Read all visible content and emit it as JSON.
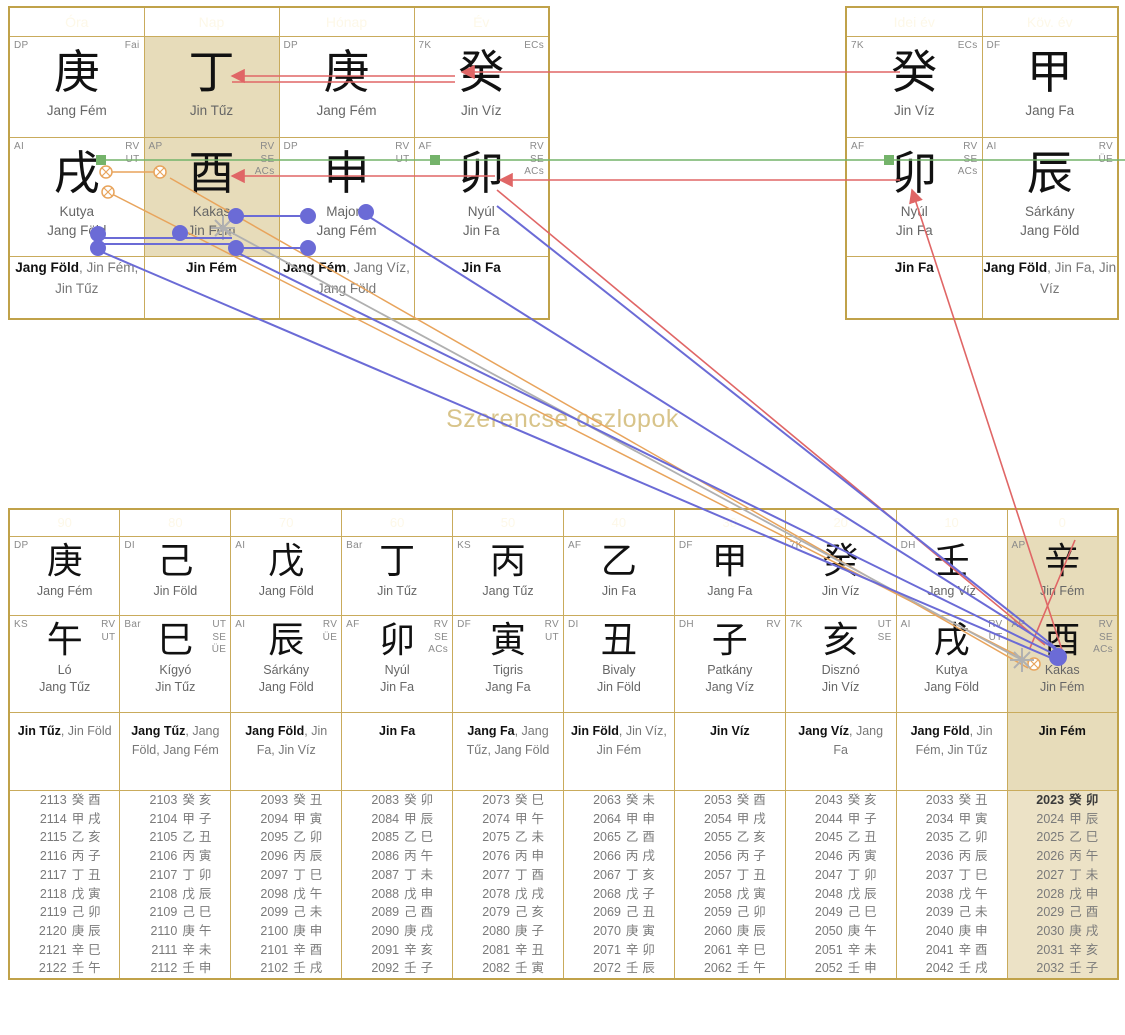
{
  "watermark": "Szerencse oszlopok",
  "natal": {
    "headers": [
      "Óra",
      "Nap",
      "Hónap",
      "Év"
    ],
    "stems": [
      {
        "tl": "DP",
        "tr": "Fai",
        "glyph": "庚",
        "element": "Jang Fém",
        "highlight": false
      },
      {
        "tl": "",
        "tr": "",
        "glyph": "丁",
        "element": "Jin Tűz",
        "highlight": true
      },
      {
        "tl": "DP",
        "tr": "",
        "glyph": "庚",
        "element": "Jang Fém",
        "highlight": false
      },
      {
        "tl": "7K",
        "tr": "ECs",
        "glyph": "癸",
        "element": "Jin Víz",
        "highlight": false
      }
    ],
    "branches": [
      {
        "tl": "AI",
        "tr": "RV\nUT",
        "glyph": "戌",
        "animal": "Kutya",
        "element": "Jang Föld",
        "highlight": false
      },
      {
        "tl": "AP",
        "tr": "RV\nSE\nACs",
        "glyph": "酉",
        "animal": "Kakas",
        "element": "Jin Fém",
        "highlight": true
      },
      {
        "tl": "DP",
        "tr": "RV\nUT",
        "glyph": "申",
        "animal": "Majom",
        "element": "Jang Fém",
        "highlight": false
      },
      {
        "tl": "AF",
        "tr": "RV\nSE\nACs",
        "glyph": "卯",
        "animal": "Nyúl",
        "element": "Jin Fa",
        "highlight": false
      }
    ],
    "hidden": [
      {
        "main": "Jang Föld",
        "rest": ", Jin Fém, Jin Tűz"
      },
      {
        "main": "Jin Fém",
        "rest": ""
      },
      {
        "main": "Jang Fém",
        "rest": ", Jang Víz, Jang Föld"
      },
      {
        "main": "Jin Fa",
        "rest": ""
      }
    ]
  },
  "annual": {
    "headers": [
      "Idei év",
      "Köv. év"
    ],
    "stems": [
      {
        "tl": "7K",
        "tr": "ECs",
        "glyph": "癸",
        "element": "Jin Víz"
      },
      {
        "tl": "DF",
        "tr": "",
        "glyph": "甲",
        "element": "Jang Fa"
      }
    ],
    "branches": [
      {
        "tl": "AF",
        "tr": "RV\nSE\nACs",
        "glyph": "卯",
        "animal": "Nyúl",
        "element": "Jin Fa"
      },
      {
        "tl": "AI",
        "tr": "RV\nÜE",
        "glyph": "辰",
        "animal": "Sárkány",
        "element": "Jang Föld"
      }
    ],
    "hidden": [
      {
        "main": "Jin Fa",
        "rest": ""
      },
      {
        "main": "Jang Föld",
        "rest": ", Jin Fa, Jin Víz"
      }
    ]
  },
  "luck": {
    "headers": [
      "90",
      "80",
      "70",
      "60",
      "50",
      "40",
      "30",
      "20",
      "10",
      "0"
    ],
    "stems": [
      {
        "tl": "DP",
        "tr": "",
        "glyph": "庚",
        "element": "Jang Fém",
        "highlight": false
      },
      {
        "tl": "DI",
        "tr": "",
        "glyph": "己",
        "element": "Jin Föld",
        "highlight": false
      },
      {
        "tl": "AI",
        "tr": "",
        "glyph": "戊",
        "element": "Jang Föld",
        "highlight": false
      },
      {
        "tl": "Bar",
        "tr": "",
        "glyph": "丁",
        "element": "Jin Tűz",
        "highlight": false
      },
      {
        "tl": "KS",
        "tr": "",
        "glyph": "丙",
        "element": "Jang Tűz",
        "highlight": false
      },
      {
        "tl": "AF",
        "tr": "",
        "glyph": "乙",
        "element": "Jin Fa",
        "highlight": false
      },
      {
        "tl": "DF",
        "tr": "",
        "glyph": "甲",
        "element": "Jang Fa",
        "highlight": false
      },
      {
        "tl": "7K",
        "tr": "",
        "glyph": "癸",
        "element": "Jin Víz",
        "highlight": false
      },
      {
        "tl": "DH",
        "tr": "",
        "glyph": "壬",
        "element": "Jang Víz",
        "highlight": false
      },
      {
        "tl": "AP",
        "tr": "",
        "glyph": "辛",
        "element": "Jin Fém",
        "highlight": true
      }
    ],
    "branches": [
      {
        "tl": "KS",
        "tr": "RV\nUT",
        "glyph": "午",
        "animal": "Ló",
        "element": "Jang Tűz",
        "highlight": false
      },
      {
        "tl": "Bar",
        "tr": "UT\nSE\nÜE",
        "glyph": "巳",
        "animal": "Kígyó",
        "element": "Jin Tűz",
        "highlight": false
      },
      {
        "tl": "AI",
        "tr": "RV\nÜE",
        "glyph": "辰",
        "animal": "Sárkány",
        "element": "Jang Föld",
        "highlight": false
      },
      {
        "tl": "AF",
        "tr": "RV\nSE\nACs",
        "glyph": "卯",
        "animal": "Nyúl",
        "element": "Jin Fa",
        "highlight": false
      },
      {
        "tl": "DF",
        "tr": "RV\nUT",
        "glyph": "寅",
        "animal": "Tigris",
        "element": "Jang Fa",
        "highlight": false
      },
      {
        "tl": "DI",
        "tr": "",
        "glyph": "丑",
        "animal": "Bivaly",
        "element": "Jin Föld",
        "highlight": false
      },
      {
        "tl": "DH",
        "tr": "RV",
        "glyph": "子",
        "animal": "Patkány",
        "element": "Jang Víz",
        "highlight": false
      },
      {
        "tl": "7K",
        "tr": "UT\nSE",
        "glyph": "亥",
        "animal": "Disznó",
        "element": "Jin Víz",
        "highlight": false
      },
      {
        "tl": "AI",
        "tr": "RV\nUT",
        "glyph": "戌",
        "animal": "Kutya",
        "element": "Jang Föld",
        "highlight": false
      },
      {
        "tl": "AP",
        "tr": "RV\nSE\nACs",
        "glyph": "酉",
        "animal": "Kakas",
        "element": "Jin Fém",
        "highlight": true
      }
    ],
    "hidden": [
      {
        "main": "Jin Tűz",
        "rest": ", Jin Föld",
        "highlight": false
      },
      {
        "main": "Jang Tűz",
        "rest": ", Jang Föld, Jang Fém",
        "highlight": false
      },
      {
        "main": "Jang Föld",
        "rest": ", Jin Fa, Jin Víz",
        "highlight": false
      },
      {
        "main": "Jin Fa",
        "rest": "",
        "highlight": false
      },
      {
        "main": "Jang Fa",
        "rest": ", Jang Tűz, Jang Föld",
        "highlight": false
      },
      {
        "main": "Jin Föld",
        "rest": ", Jin Víz, Jin Fém",
        "highlight": false
      },
      {
        "main": "Jin Víz",
        "rest": "",
        "highlight": false
      },
      {
        "main": "Jang Víz",
        "rest": ", Jang Fa",
        "highlight": false
      },
      {
        "main": "Jang Föld",
        "rest": ", Jin Fém, Jin Tűz",
        "highlight": false
      },
      {
        "main": "Jin Fém",
        "rest": "",
        "highlight": true
      }
    ],
    "years": [
      {
        "highlight": false,
        "rows": [
          {
            "y": "2113",
            "gz": "癸 酉"
          },
          {
            "y": "2114",
            "gz": "甲 戌"
          },
          {
            "y": "2115",
            "gz": "乙 亥"
          },
          {
            "y": "2116",
            "gz": "丙 子"
          },
          {
            "y": "2117",
            "gz": "丁 丑"
          },
          {
            "y": "2118",
            "gz": "戊 寅"
          },
          {
            "y": "2119",
            "gz": "己 卯"
          },
          {
            "y": "2120",
            "gz": "庚 辰"
          },
          {
            "y": "2121",
            "gz": "辛 巳"
          },
          {
            "y": "2122",
            "gz": "壬 午"
          }
        ]
      },
      {
        "highlight": false,
        "rows": [
          {
            "y": "2103",
            "gz": "癸 亥"
          },
          {
            "y": "2104",
            "gz": "甲 子"
          },
          {
            "y": "2105",
            "gz": "乙 丑"
          },
          {
            "y": "2106",
            "gz": "丙 寅"
          },
          {
            "y": "2107",
            "gz": "丁 卯"
          },
          {
            "y": "2108",
            "gz": "戊 辰"
          },
          {
            "y": "2109",
            "gz": "己 巳"
          },
          {
            "y": "2110",
            "gz": "庚 午"
          },
          {
            "y": "2111",
            "gz": "辛 未"
          },
          {
            "y": "2112",
            "gz": "壬 申"
          }
        ]
      },
      {
        "highlight": false,
        "rows": [
          {
            "y": "2093",
            "gz": "癸 丑"
          },
          {
            "y": "2094",
            "gz": "甲 寅"
          },
          {
            "y": "2095",
            "gz": "乙 卯"
          },
          {
            "y": "2096",
            "gz": "丙 辰"
          },
          {
            "y": "2097",
            "gz": "丁 巳"
          },
          {
            "y": "2098",
            "gz": "戊 午"
          },
          {
            "y": "2099",
            "gz": "己 未"
          },
          {
            "y": "2100",
            "gz": "庚 申"
          },
          {
            "y": "2101",
            "gz": "辛 酉"
          },
          {
            "y": "2102",
            "gz": "壬 戌"
          }
        ]
      },
      {
        "highlight": false,
        "rows": [
          {
            "y": "2083",
            "gz": "癸 卯"
          },
          {
            "y": "2084",
            "gz": "甲 辰"
          },
          {
            "y": "2085",
            "gz": "乙 巳"
          },
          {
            "y": "2086",
            "gz": "丙 午"
          },
          {
            "y": "2087",
            "gz": "丁 未"
          },
          {
            "y": "2088",
            "gz": "戊 申"
          },
          {
            "y": "2089",
            "gz": "己 酉"
          },
          {
            "y": "2090",
            "gz": "庚 戌"
          },
          {
            "y": "2091",
            "gz": "辛 亥"
          },
          {
            "y": "2092",
            "gz": "壬 子"
          }
        ]
      },
      {
        "highlight": false,
        "rows": [
          {
            "y": "2073",
            "gz": "癸 巳"
          },
          {
            "y": "2074",
            "gz": "甲 午"
          },
          {
            "y": "2075",
            "gz": "乙 未"
          },
          {
            "y": "2076",
            "gz": "丙 申"
          },
          {
            "y": "2077",
            "gz": "丁 酉"
          },
          {
            "y": "2078",
            "gz": "戊 戌"
          },
          {
            "y": "2079",
            "gz": "己 亥"
          },
          {
            "y": "2080",
            "gz": "庚 子"
          },
          {
            "y": "2081",
            "gz": "辛 丑"
          },
          {
            "y": "2082",
            "gz": "壬 寅"
          }
        ]
      },
      {
        "highlight": false,
        "rows": [
          {
            "y": "2063",
            "gz": "癸 未"
          },
          {
            "y": "2064",
            "gz": "甲 申"
          },
          {
            "y": "2065",
            "gz": "乙 酉"
          },
          {
            "y": "2066",
            "gz": "丙 戌"
          },
          {
            "y": "2067",
            "gz": "丁 亥"
          },
          {
            "y": "2068",
            "gz": "戊 子"
          },
          {
            "y": "2069",
            "gz": "己 丑"
          },
          {
            "y": "2070",
            "gz": "庚 寅"
          },
          {
            "y": "2071",
            "gz": "辛 卯"
          },
          {
            "y": "2072",
            "gz": "壬 辰"
          }
        ]
      },
      {
        "highlight": false,
        "rows": [
          {
            "y": "2053",
            "gz": "癸 酉"
          },
          {
            "y": "2054",
            "gz": "甲 戌"
          },
          {
            "y": "2055",
            "gz": "乙 亥"
          },
          {
            "y": "2056",
            "gz": "丙 子"
          },
          {
            "y": "2057",
            "gz": "丁 丑"
          },
          {
            "y": "2058",
            "gz": "戊 寅"
          },
          {
            "y": "2059",
            "gz": "己 卯"
          },
          {
            "y": "2060",
            "gz": "庚 辰"
          },
          {
            "y": "2061",
            "gz": "辛 巳"
          },
          {
            "y": "2062",
            "gz": "壬 午"
          }
        ]
      },
      {
        "highlight": false,
        "rows": [
          {
            "y": "2043",
            "gz": "癸 亥"
          },
          {
            "y": "2044",
            "gz": "甲 子"
          },
          {
            "y": "2045",
            "gz": "乙 丑"
          },
          {
            "y": "2046",
            "gz": "丙 寅"
          },
          {
            "y": "2047",
            "gz": "丁 卯"
          },
          {
            "y": "2048",
            "gz": "戊 辰"
          },
          {
            "y": "2049",
            "gz": "己 巳"
          },
          {
            "y": "2050",
            "gz": "庚 午"
          },
          {
            "y": "2051",
            "gz": "辛 未"
          },
          {
            "y": "2052",
            "gz": "壬 申"
          }
        ]
      },
      {
        "highlight": false,
        "rows": [
          {
            "y": "2033",
            "gz": "癸 丑"
          },
          {
            "y": "2034",
            "gz": "甲 寅"
          },
          {
            "y": "2035",
            "gz": "乙 卯"
          },
          {
            "y": "2036",
            "gz": "丙 辰"
          },
          {
            "y": "2037",
            "gz": "丁 巳"
          },
          {
            "y": "2038",
            "gz": "戊 午"
          },
          {
            "y": "2039",
            "gz": "己 未"
          },
          {
            "y": "2040",
            "gz": "庚 申"
          },
          {
            "y": "2041",
            "gz": "辛 酉"
          },
          {
            "y": "2042",
            "gz": "壬 戌"
          }
        ]
      },
      {
        "highlight": true,
        "rows": [
          {
            "y": "2023",
            "gz": "癸 卯"
          },
          {
            "y": "2024",
            "gz": "甲 辰"
          },
          {
            "y": "2025",
            "gz": "乙 巳"
          },
          {
            "y": "2026",
            "gz": "丙 午"
          },
          {
            "y": "2027",
            "gz": "丁 未"
          },
          {
            "y": "2028",
            "gz": "戊 申"
          },
          {
            "y": "2029",
            "gz": "己 酉"
          },
          {
            "y": "2030",
            "gz": "庚 戌"
          },
          {
            "y": "2031",
            "gz": "辛 亥"
          },
          {
            "y": "2032",
            "gz": "壬 子"
          }
        ]
      }
    ]
  },
  "colors": {
    "header_bg": "#bfa14f",
    "border": "#c9ab5c",
    "highlight_bg": "#e7dcba",
    "relation_red": "#e06666",
    "relation_green": "#74b36a",
    "relation_blue": "#6b6bd6",
    "relation_orange": "#e8a45c",
    "relation_gray": "#b0b0b0",
    "watermark": "#d8c48a"
  }
}
